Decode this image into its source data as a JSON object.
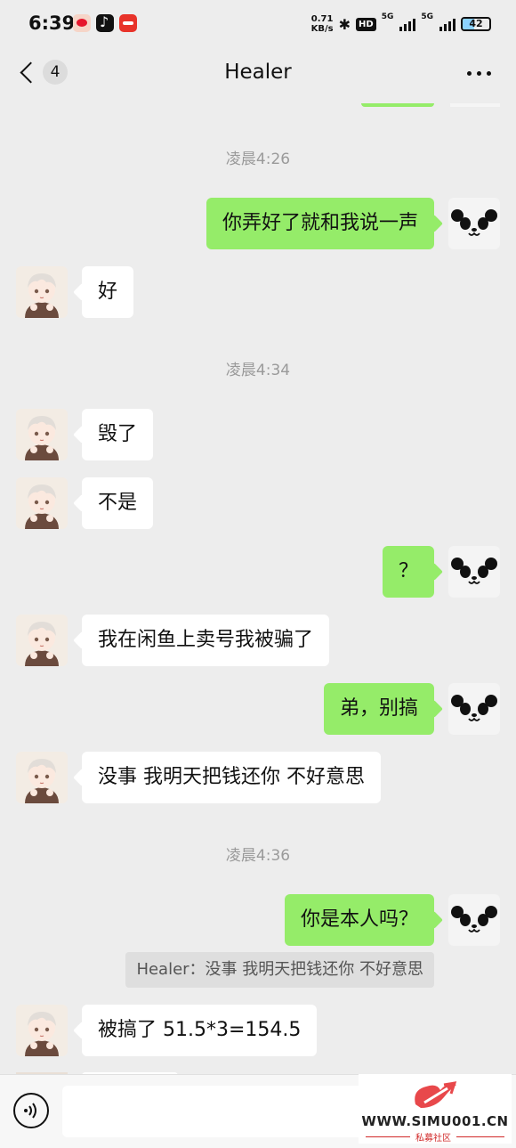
{
  "status_bar": {
    "time": "6:39",
    "net_speed_value": "0.71",
    "net_speed_unit": "KB/s",
    "hd_label": "HD",
    "signal1_label": "5G",
    "signal2_label": "5G",
    "battery_level": "42",
    "battery_fraction": 0.42
  },
  "header": {
    "back_badge_count": "4",
    "title": "Healer"
  },
  "messages": {
    "ts1": "凌晨4:26",
    "m1": "你弄好了就和我说一声",
    "m2": "好",
    "ts2": "凌晨4:34",
    "m3": "毁了",
    "m4": "不是",
    "m5": "？",
    "m6": "我在闲鱼上卖号我被骗了",
    "m7": "弟，别搞",
    "m8": "没事 我明天把钱还你  不好意思",
    "ts3": "凌晨4:36",
    "m9": "你是本人吗？",
    "quote": "Healer：没事 我明天把钱还你  不好意思",
    "m10": "被搞了 51.5*3=154.5"
  },
  "input_bar": {
    "value": ""
  },
  "watermark": {
    "site": "WWW.SIMU001.CN",
    "name": "私募社区"
  },
  "colors": {
    "background": "#ededed",
    "sent_bubble": "#95ec69",
    "received_bubble": "#ffffff",
    "timestamp_text": "#9a9a9a"
  }
}
